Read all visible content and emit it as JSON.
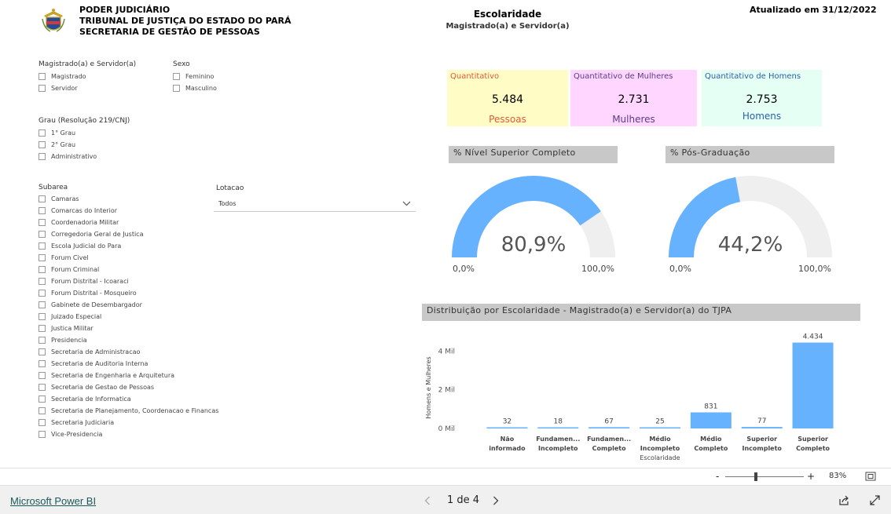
{
  "header": {
    "org_line1": "PODER JUDICIÁRIO",
    "org_line2": "TRIBUNAL DE JUSTIÇA DO ESTADO DO PARÁ",
    "org_line3": "SECRETARIA DE GESTÃO DE PESSOAS",
    "title": "Escolaridade",
    "subtitle": "Magistrado(a) e Servidor(a)",
    "updated": "Atualizado em 31/12/2022"
  },
  "filters": {
    "category": {
      "title": "Magistrado(a) e Servidor(a)",
      "options": [
        "Magistrado",
        "Servidor"
      ]
    },
    "sex": {
      "title": "Sexo",
      "options": [
        "Feminino",
        "Masculino"
      ]
    },
    "grade": {
      "title": "Grau (Resolução 219/CNJ)",
      "options": [
        "1° Grau",
        "2° Grau",
        "Administrativo"
      ]
    },
    "subarea": {
      "title": "Subarea",
      "options": [
        "Camaras",
        "Comarcas do Interior",
        "Coordenadoria Militar",
        "Corregedoria Geral de Justica",
        "Escola Judicial do Para",
        "Forum Civel",
        "Forum Criminal",
        "Forum Distrital - Icoaraci",
        "Forum Distrital - Mosqueiro",
        "Gabinete de Desembargador",
        "Juizado Especial",
        "Justica Militar",
        "Presidencia",
        "Secretaria de Administracao",
        "Secretaria de Auditoria Interna",
        "Secretaria de Engenharia e Arquitetura",
        "Secretaria de Gestao de Pessoas",
        "Secretaria de Informatica",
        "Secretaria de Planejamento, Coordenacao e Financas",
        "Secretaria Judiciaria",
        "Vice-Presidencia"
      ]
    },
    "lotacao": {
      "title": "Lotacao",
      "value": "Todos"
    }
  },
  "cards": {
    "total": {
      "title": "Quantitativo",
      "value": "5.484",
      "sub": "Pessoas",
      "bg": "#fffcc5",
      "color": "#e0593d"
    },
    "women": {
      "title": "Quantitativo de Mulheres",
      "value": "2.731",
      "sub": "Mulheres",
      "bg": "#ffd6ff",
      "color": "#5b3c8a"
    },
    "men": {
      "title": "Quantitativo de Homens",
      "value": "2.753",
      "sub": "Homens",
      "bg": "#e6fff5",
      "color": "#2a5fa8"
    }
  },
  "gauges": [
    {
      "title": "% Nível Superior Completo",
      "value": 80.9,
      "label": "80,9%",
      "min": "0,0%",
      "max": "100,0%"
    },
    {
      "title": "% Pós-Graduação",
      "value": 44.2,
      "label": "44,2%",
      "min": "0,0%",
      "max": "100,0%"
    }
  ],
  "chart_data": {
    "type": "bar",
    "title": "Distribuição por Escolaridade - Magistrado(a) e Servidor(a) do TJPA",
    "ylabel": "Homens e Mulheres",
    "xlabel": "Escolaridade",
    "categories": [
      "Não informado",
      "Fundamen... Incompleto",
      "Fundamen... Completo",
      "Médio Incompleto",
      "Médio Completo",
      "Superior Incompleto",
      "Superior Completo"
    ],
    "category_lines": [
      [
        "Não",
        "informado"
      ],
      [
        "Fundamen...",
        "Incompleto"
      ],
      [
        "Fundamen...",
        "Completo"
      ],
      [
        "Médio",
        "Incompleto"
      ],
      [
        "Médio",
        "Completo"
      ],
      [
        "Superior",
        "Incompleto"
      ],
      [
        "Superior",
        "Completo"
      ]
    ],
    "values": [
      32,
      18,
      67,
      25,
      831,
      77,
      4434
    ],
    "value_labels": [
      "32",
      "18",
      "67",
      "25",
      "831",
      "77",
      "4.434"
    ],
    "yticks": [
      0,
      2000,
      4000
    ],
    "ytick_labels": [
      "0 Mil",
      "2 Mil",
      "4 Mil"
    ],
    "ylim": [
      0,
      4700
    ],
    "color": "#66b2ff"
  },
  "zoom": {
    "minus": "-",
    "plus": "+",
    "level": "83%"
  },
  "footer": {
    "brand": "Microsoft Power BI",
    "page": "1 de 4"
  },
  "colors": {
    "gauge_fill": "#66b2ff",
    "gauge_track": "#f0efef"
  }
}
